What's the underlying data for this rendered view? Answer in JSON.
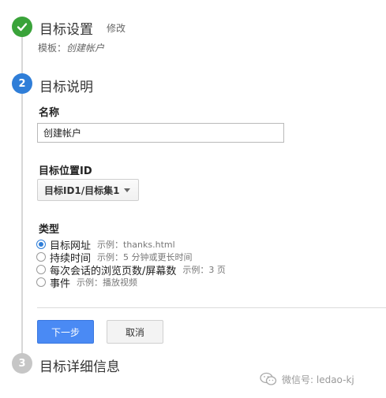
{
  "steps": [
    {
      "number": "✓",
      "title": "目标设置",
      "edit_label": "修改",
      "template_prefix": "模板：",
      "template_value": "创建帐户"
    },
    {
      "number": "2",
      "title": "目标说明"
    },
    {
      "number": "3",
      "title": "目标详细信息"
    }
  ],
  "form": {
    "name_label": "名称",
    "name_value": "创建帐户",
    "goal_id_label": "目标位置ID",
    "goal_id_value": "目标ID1/目标集1",
    "type_label": "类型",
    "types": [
      {
        "label": "目标网址",
        "example": "示例：thanks.html",
        "checked": true
      },
      {
        "label": "持续时间",
        "example": "示例：5 分钟或更长时间",
        "checked": false
      },
      {
        "label": "每次会话的浏览页数/屏幕数",
        "example": "示例：3 页",
        "checked": false
      },
      {
        "label": "事件",
        "example": "示例：播放视频",
        "checked": false
      }
    ]
  },
  "buttons": {
    "next": "下一步",
    "cancel": "取消"
  },
  "watermark": {
    "text": "微信号: ledao-kj"
  },
  "colors": {
    "complete": "#3aa33a",
    "active": "#2f7ed8",
    "inactive": "#c6c6c6",
    "primary_button": "#4a8af4"
  }
}
